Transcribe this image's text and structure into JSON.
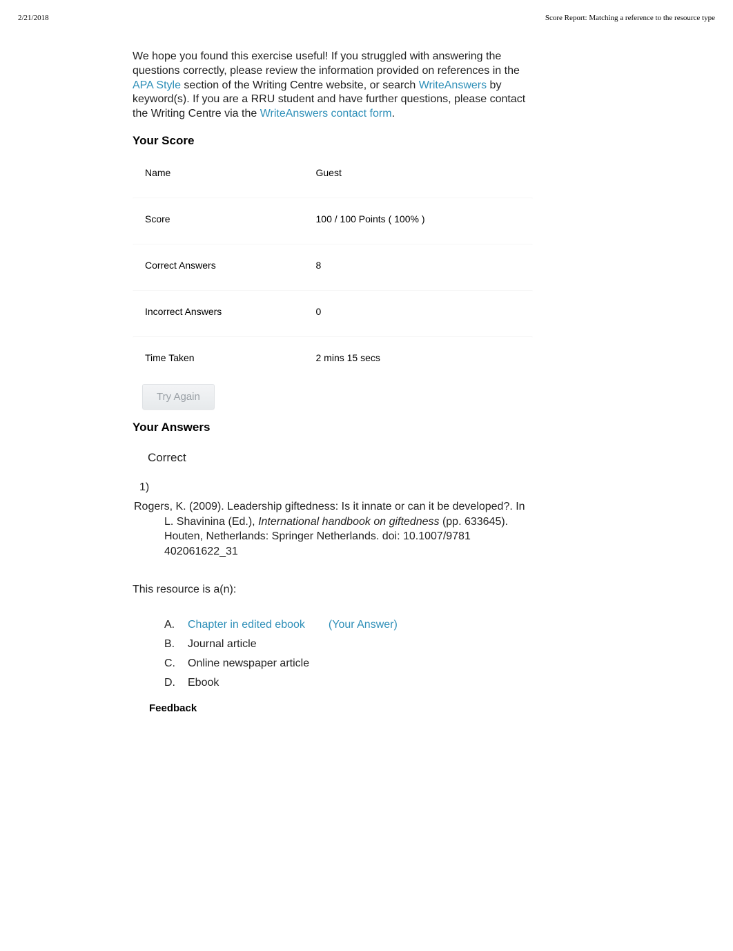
{
  "header": {
    "date": "2/21/2018",
    "title": "Score Report: Matching a reference to the resource type"
  },
  "intro": {
    "line1_pre": "We hope you found this exercise useful! If you struggled with answering the questions correctly, please review the information provided on references in the ",
    "link_apa": "APA Style",
    "line1_mid": " section of the Writing Centre website, or search ",
    "link_writeanswers": "WriteAnswers",
    "line1_post": " by keyword(s). If you are a RRU student and have further questions, please contact the Writing Centre via the ",
    "link_form": "WriteAnswers contact form",
    "line1_end": "."
  },
  "score": {
    "heading": "Your Score",
    "rows": [
      {
        "label": "Name",
        "value": "Guest"
      },
      {
        "label": "Score",
        "value": "100 / 100   Points ( 100% )"
      },
      {
        "label": "Correct Answers",
        "value": "8"
      },
      {
        "label": "Incorrect Answers",
        "value": "0"
      },
      {
        "label": "Time Taken",
        "value": "2 mins 15 secs"
      }
    ],
    "try_again": "Try Again"
  },
  "answers": {
    "heading": "Your Answers",
    "correct_label": "Correct",
    "question_number": "1)",
    "reference_line": "Rogers, K. (2009). Leadership giftedness: Is it innate or can it be developed?. In L. Shavinina (Ed.), ",
    "reference_italic": "International handbook on giftedness",
    "reference_tail": " (pp. 633645). Houten, Netherlands: Springer Netherlands. doi: 10.1007/9781 402061622_31",
    "prompt": "This resource is a(n):",
    "options": [
      {
        "letter": "A.",
        "text": "Chapter in edited ebook",
        "selected": true,
        "your_answer_label": "(Your Answer)"
      },
      {
        "letter": "B.",
        "text": "Journal article",
        "selected": false
      },
      {
        "letter": "C.",
        "text": "Online newspaper article",
        "selected": false
      },
      {
        "letter": "D.",
        "text": "Ebook",
        "selected": false
      }
    ],
    "feedback_heading": "Feedback"
  }
}
